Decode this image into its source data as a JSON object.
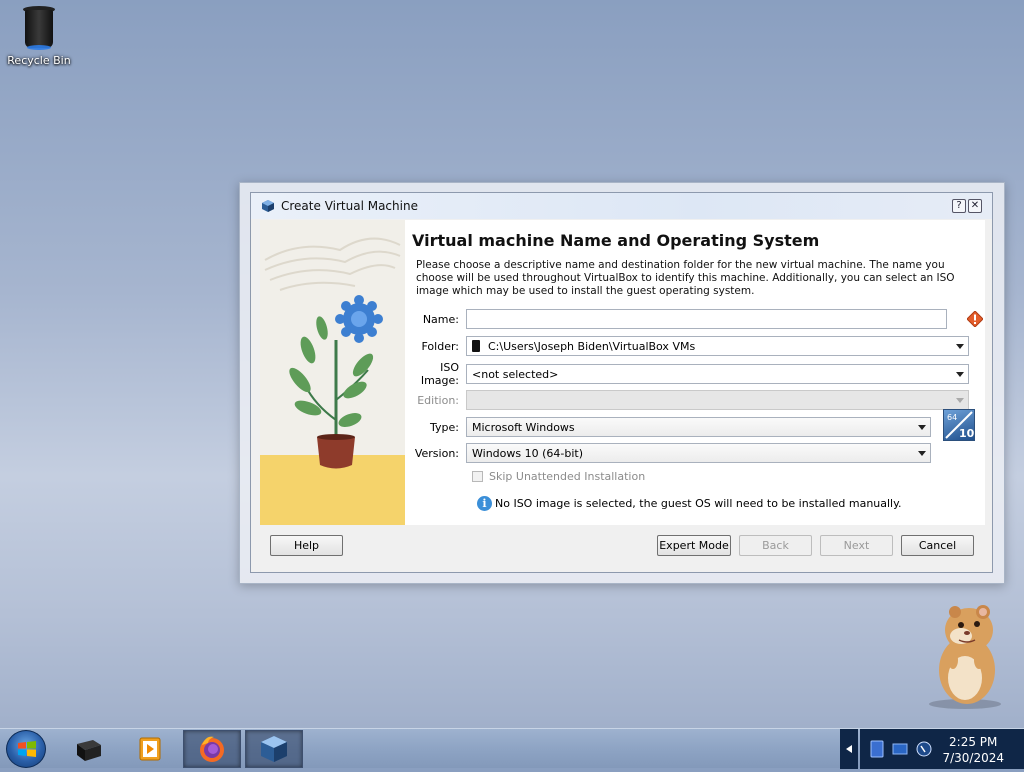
{
  "desktop": {
    "icons": [
      {
        "label": "Recycle Bin",
        "icon": "recycle-bin-icon"
      }
    ]
  },
  "dialog": {
    "title": "Create Virtual Machine",
    "help_glyph": "?",
    "close_glyph": "✕",
    "heading": "Virtual machine Name and Operating System",
    "description": "Please choose a descriptive name and destination folder for the new virtual machine. The name you choose will be used throughout VirtualBox to identify this machine. Additionally, you can select an ISO image which may be used to install the guest operating system.",
    "fields": {
      "name": {
        "label": "Name:",
        "value": ""
      },
      "folder": {
        "label": "Folder:",
        "value": "C:\\Users\\Joseph Biden\\VirtualBox VMs"
      },
      "iso": {
        "label": "ISO Image:",
        "value": "<not selected>"
      },
      "edition": {
        "label": "Edition:",
        "value": ""
      },
      "type": {
        "label": "Type:",
        "value": "Microsoft Windows"
      },
      "version": {
        "label": "Version:",
        "value": "Windows 10 (64-bit)"
      }
    },
    "os_badge": {
      "top": "64",
      "bottom": "10"
    },
    "skip_unattended": {
      "label": "Skip Unattended Installation",
      "checked": false
    },
    "info_message": "No ISO image is selected, the guest OS will need to be installed manually.",
    "buttons": {
      "help": "Help",
      "expert": "Expert Mode",
      "back": "Back",
      "next": "Next",
      "cancel": "Cancel"
    }
  },
  "taskbar": {
    "apps": [
      {
        "name": "black-box-app-icon",
        "active": false
      },
      {
        "name": "media-player-icon",
        "active": false
      },
      {
        "name": "firefox-icon",
        "active": true
      },
      {
        "name": "virtualbox-icon",
        "active": true
      }
    ],
    "clock": {
      "time": "2:25 PM",
      "date": "7/30/2024"
    },
    "tray_icons": [
      "show-hidden-icons-arrow-icon",
      "network-icon",
      "action-center-icon",
      "volume-icon"
    ]
  },
  "colors": {
    "accent": "#3b8fd8",
    "warning": "#e35d2b",
    "taskbar_tray": "#0f2647"
  }
}
